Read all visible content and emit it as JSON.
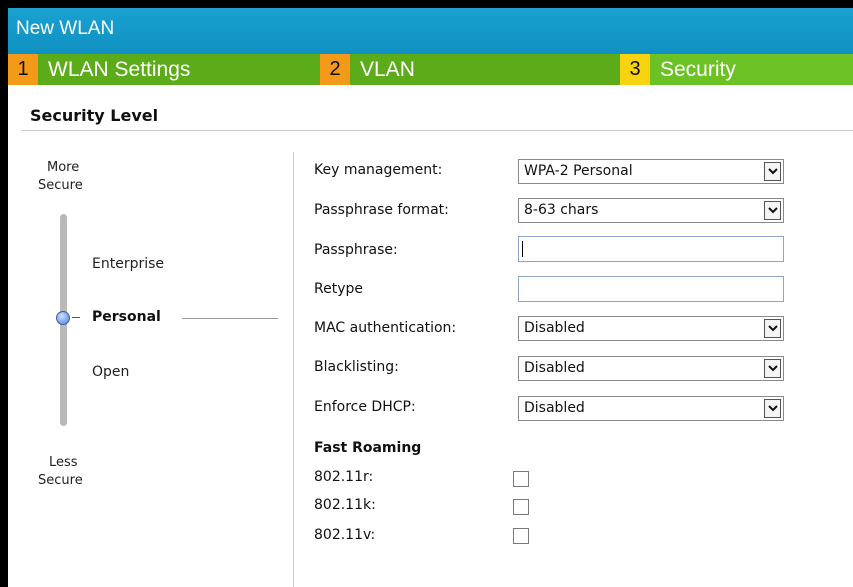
{
  "window": {
    "title": "New WLAN"
  },
  "tabs": [
    {
      "num": "1",
      "label": "WLAN Settings"
    },
    {
      "num": "2",
      "label": "VLAN"
    },
    {
      "num": "3",
      "label": "Security"
    }
  ],
  "section": {
    "title": "Security Level"
  },
  "slider": {
    "top_label_1": "More",
    "top_label_2": "Secure",
    "bottom_label_1": "Less",
    "bottom_label_2": "Secure",
    "levels": [
      "Enterprise",
      "Personal",
      "Open"
    ],
    "selected": "Personal"
  },
  "form": {
    "key_management": {
      "label": "Key management:",
      "value": "WPA-2 Personal"
    },
    "passphrase_format": {
      "label": "Passphrase format:",
      "value": "8-63 chars"
    },
    "passphrase": {
      "label": "Passphrase:",
      "value": ""
    },
    "retype": {
      "label": "Retype",
      "value": ""
    },
    "mac_auth": {
      "label": "MAC authentication:",
      "value": "Disabled"
    },
    "blacklisting": {
      "label": "Blacklisting:",
      "value": "Disabled"
    },
    "enforce_dhcp": {
      "label": "Enforce DHCP:",
      "value": "Disabled"
    }
  },
  "fast_roaming": {
    "title": "Fast Roaming",
    "items": [
      {
        "label": "802.11r:",
        "checked": false
      },
      {
        "label": "802.11k:",
        "checked": false
      },
      {
        "label": "802.11v:",
        "checked": false
      }
    ]
  },
  "colors": {
    "title_bar": "#1099c9",
    "tab_green": "#5cab19",
    "tab_active_green": "#6cc225",
    "tab_number_orange": "#f39a1a",
    "tab_number_active_yellow": "#f7d40f"
  }
}
